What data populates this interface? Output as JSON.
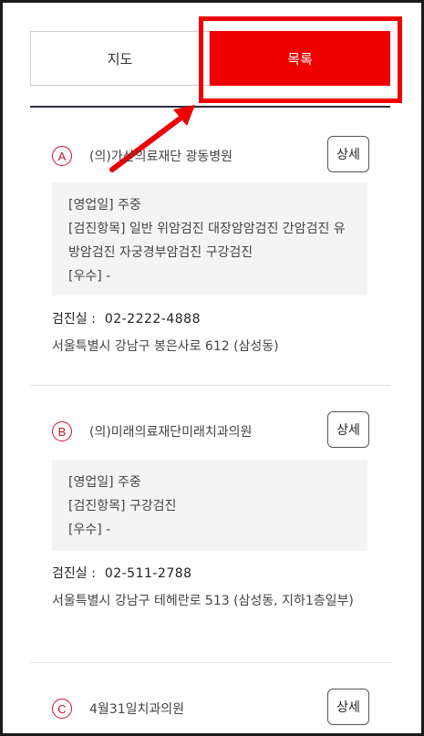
{
  "tabs": {
    "map": "지도",
    "list": "목록"
  },
  "colors": {
    "accent": "#ee0000",
    "badge": "#d0102a",
    "info_bg": "#f4f4f4"
  },
  "items": [
    {
      "letter": "A",
      "name": "(의)가산의료재단 광동병원",
      "detail_label": "상세",
      "info": [
        "[영업일] 주중",
        "[검진항목] 일반 위암검진 대장암암검진 간암검진 유방암검진 자궁경부암검진 구강검진",
        "[우수] -"
      ],
      "phone_label": "검진실 :",
      "phone": "02-2222-4888",
      "address": "서울특별시 강남구 봉은사로 612 (삼성동)"
    },
    {
      "letter": "B",
      "name": "(의)미래의료재단미래치과의원",
      "detail_label": "상세",
      "info": [
        "[영업일] 주중",
        "[검진항목] 구강검진",
        "[우수] -"
      ],
      "phone_label": "검진실 :",
      "phone": "02-511-2788",
      "address": "서울특별시 강남구 테헤란로 513 (삼성동, 지하1층일부)"
    },
    {
      "letter": "C",
      "name": "4월31일치과의원",
      "detail_label": "상세"
    }
  ]
}
